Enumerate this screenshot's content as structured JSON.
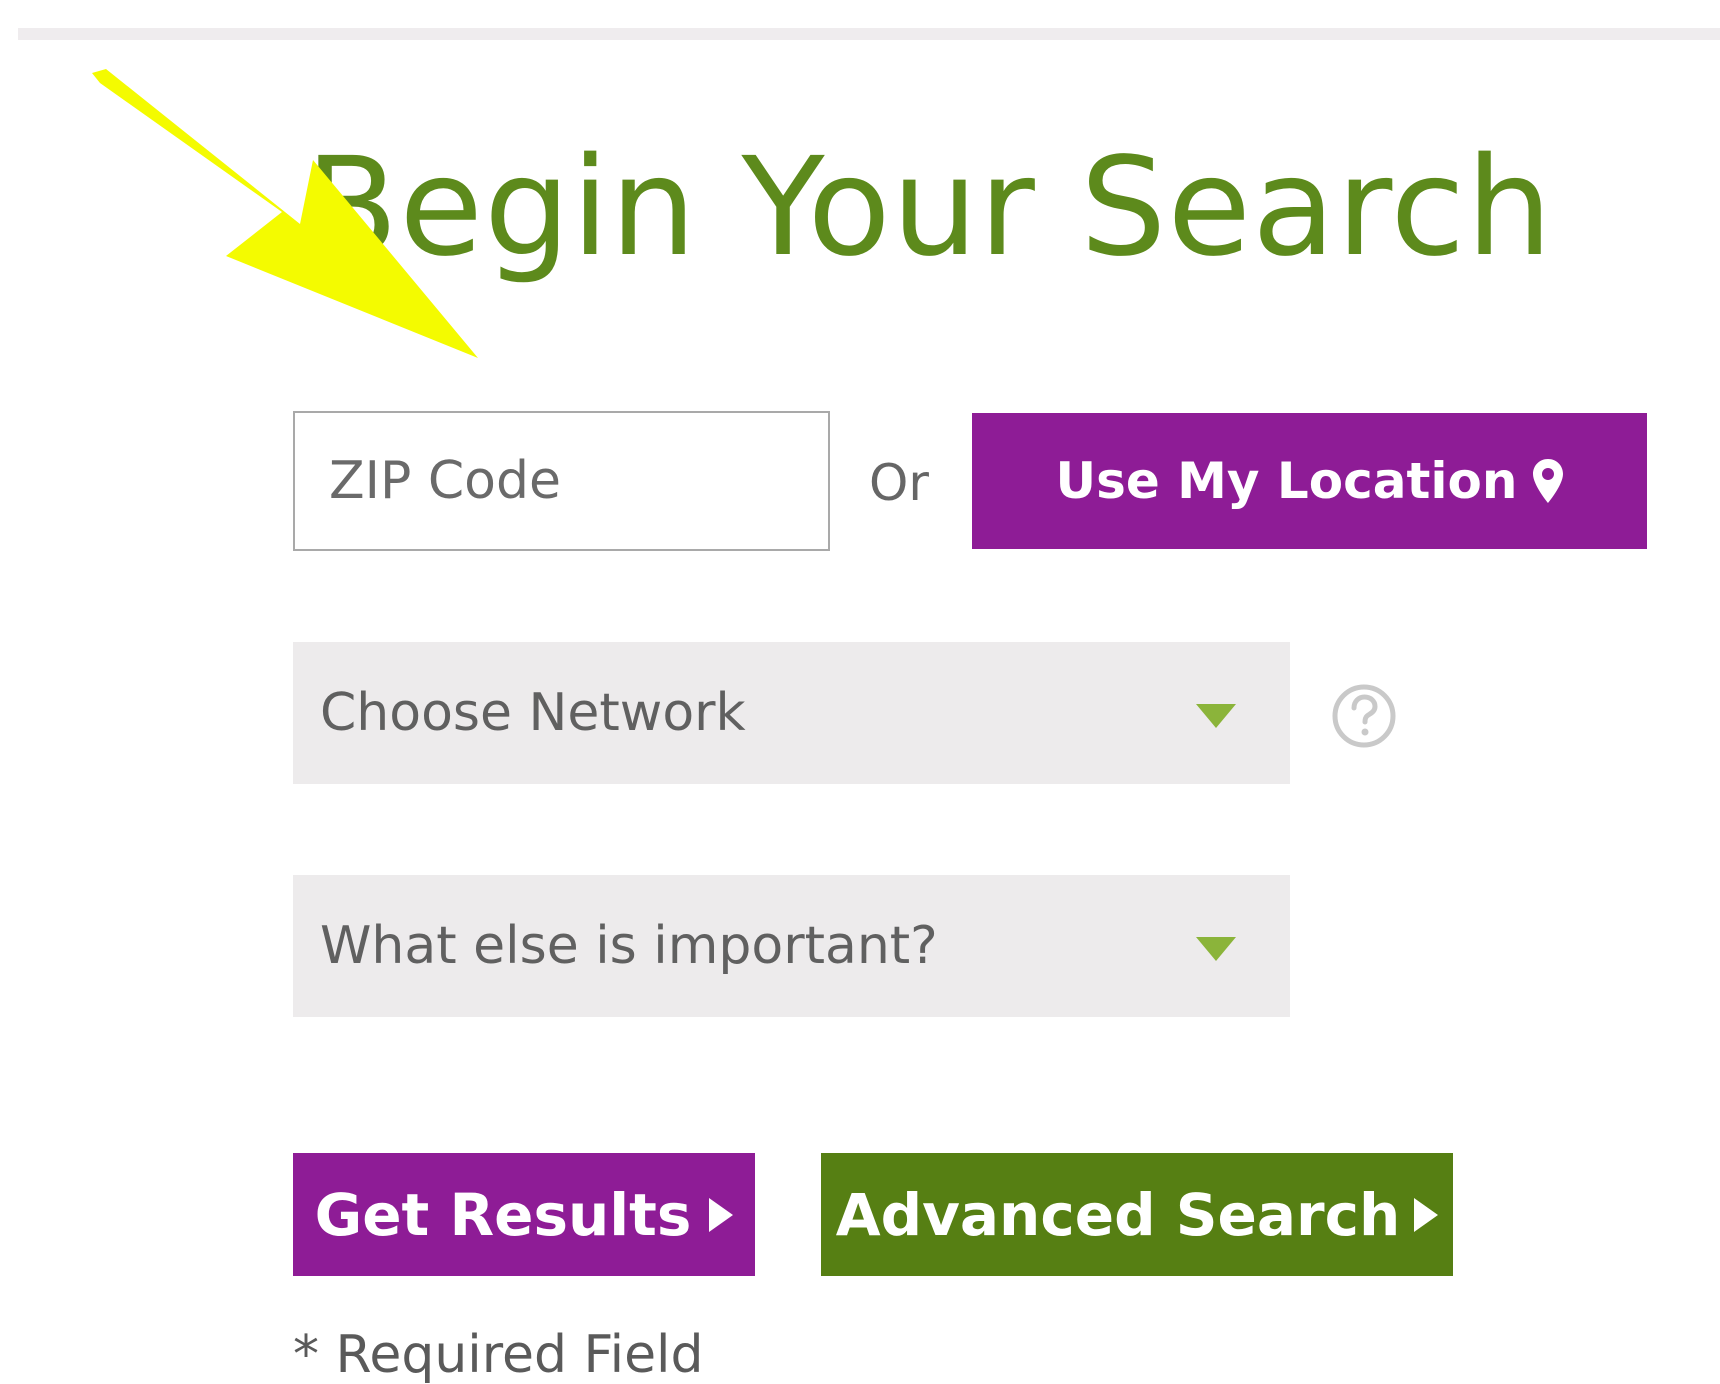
{
  "page": {
    "title": "Begin Your Search",
    "title_color": "#5d8a1c"
  },
  "search": {
    "zip_placeholder": "ZIP Code",
    "zip_value": "",
    "or_label": "Or",
    "use_location_label": "Use My Location",
    "location_icon": "map-pin-icon"
  },
  "filters": {
    "network_placeholder": "Choose Network",
    "important_placeholder": "What else is important?",
    "help_icon": "question-circle-icon"
  },
  "actions": {
    "get_results_label": "Get Results",
    "advanced_search_label": "Advanced Search"
  },
  "footer": {
    "required_note": "* Required Field"
  },
  "annotation": {
    "icon": "arrow-icon",
    "color": "#f4fb00"
  },
  "colors": {
    "purple": "#8e1c96",
    "green": "#567f13",
    "caret": "#8bb43a",
    "field_bg": "#edebec"
  }
}
